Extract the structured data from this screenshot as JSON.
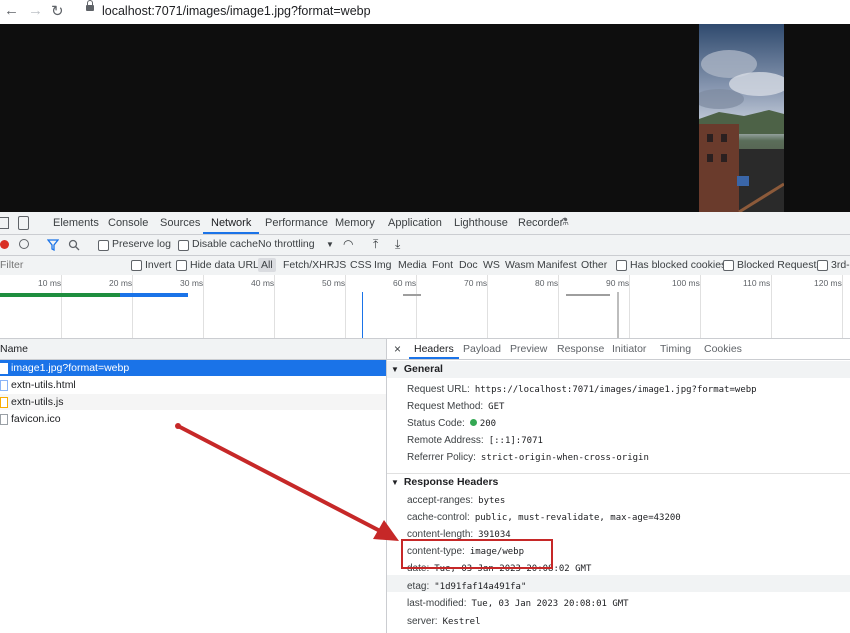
{
  "browser": {
    "back": "←",
    "forward": "→",
    "reload": "↻",
    "url": "localhost:7071/images/image1.jpg?format=webp"
  },
  "devtools": {
    "tabs": [
      "Elements",
      "Console",
      "Sources",
      "Network",
      "Performance",
      "Memory",
      "Application",
      "Lighthouse",
      "Recorder"
    ],
    "active_tab": "Network",
    "toolbar": {
      "preserve_log": "Preserve log",
      "disable_cache": "Disable cache",
      "throttling": "No throttling"
    },
    "filter": {
      "placeholder": "Filter",
      "invert": "Invert",
      "hide_data_urls": "Hide data URLs",
      "types": [
        "All",
        "Fetch/XHR",
        "JS",
        "CSS",
        "Img",
        "Media",
        "Font",
        "Doc",
        "WS",
        "Wasm",
        "Manifest",
        "Other"
      ],
      "blocked_cookies": "Has blocked cookies",
      "blocked_requests": "Blocked Requests",
      "third_party": "3rd-"
    },
    "timeline_ticks": [
      "10 ms",
      "20 ms",
      "30 ms",
      "40 ms",
      "50 ms",
      "60 ms",
      "70 ms",
      "80 ms",
      "90 ms",
      "100 ms",
      "110 ms",
      "120 ms"
    ],
    "requests": {
      "header": "Name",
      "items": [
        "image1.jpg?format=webp",
        "extn-utils.html",
        "extn-utils.js",
        "favicon.ico"
      ]
    },
    "headers_panel": {
      "close": "×",
      "tabs": [
        "Headers",
        "Payload",
        "Preview",
        "Response",
        "Initiator",
        "Timing",
        "Cookies"
      ],
      "active_tab": "Headers",
      "general_title": "General",
      "general": [
        {
          "k": "Request URL:",
          "v": "https://localhost:7071/images/image1.jpg?format=webp"
        },
        {
          "k": "Request Method:",
          "v": "GET"
        },
        {
          "k": "Status Code:",
          "v": "200"
        },
        {
          "k": "Remote Address:",
          "v": "[::1]:7071"
        },
        {
          "k": "Referrer Policy:",
          "v": "strict-origin-when-cross-origin"
        }
      ],
      "response_title": "Response Headers",
      "response": [
        {
          "k": "accept-ranges:",
          "v": "bytes"
        },
        {
          "k": "cache-control:",
          "v": "public, must-revalidate, max-age=43200"
        },
        {
          "k": "content-length:",
          "v": "391034"
        },
        {
          "k": "content-type:",
          "v": "image/webp"
        },
        {
          "k": "date:",
          "v": "Tue, 03 Jan 2023 20:08:02 GMT"
        },
        {
          "k": "etag:",
          "v": "\"1d91faf14a491fa\""
        },
        {
          "k": "last-modified:",
          "v": "Tue, 03 Jan 2023 20:08:01 GMT"
        },
        {
          "k": "server:",
          "v": "Kestrel"
        }
      ]
    }
  },
  "colors": {
    "accent": "#1a73e8",
    "highlight": "#c62828",
    "status_ok": "#34a853"
  }
}
